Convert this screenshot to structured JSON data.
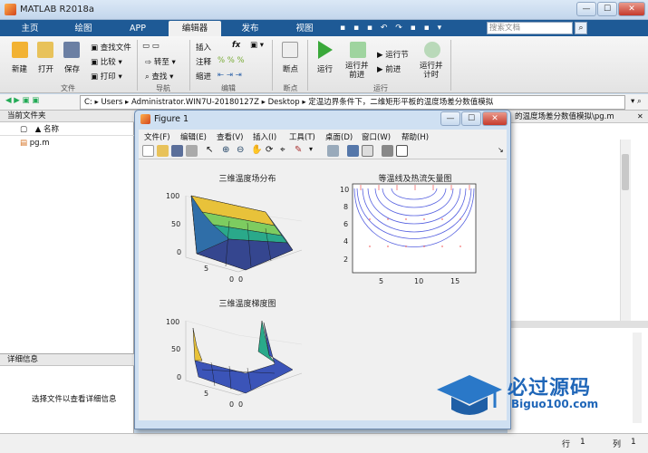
{
  "app": {
    "title": "MATLAB R2018a"
  },
  "window_controls": {
    "minimize": "—",
    "maximize": "☐",
    "close": "✕"
  },
  "tabs": [
    {
      "label": "主页"
    },
    {
      "label": "绘图"
    },
    {
      "label": "APP"
    },
    {
      "label": "编辑器"
    },
    {
      "label": "发布"
    },
    {
      "label": "视图"
    }
  ],
  "search": {
    "placeholder": "搜索文档"
  },
  "ribbon": {
    "file": {
      "new": "新建",
      "open": "打开",
      "save": "保存",
      "find_files": "查找文件",
      "compare": "比较",
      "print": "打印",
      "group": "文件"
    },
    "navigate": {
      "insert": "插入",
      "goto": "转至",
      "find": "查找",
      "group": "导航"
    },
    "edit": {
      "comment": "注释",
      "indent": "缩进",
      "fx": "fx",
      "group": "编辑"
    },
    "breakpoints": {
      "label": "断点",
      "group": "断点"
    },
    "run": {
      "run": "运行",
      "run_advance": "运行并\n前进",
      "run_section": "运行节",
      "advance": "前进",
      "run_time": "运行并\n计时",
      "group": "运行"
    }
  },
  "address": {
    "segments": [
      "C:",
      "Users",
      "Administrator.WIN7U-20180127Z",
      "Desktop",
      "定温边界条件下，二维矩形平板的温度场差分数值模拟"
    ]
  },
  "left_panel": {
    "title": "当前文件夹",
    "column": "名称",
    "sort_indicator": "▲",
    "files": [
      {
        "name": "pg.m"
      }
    ]
  },
  "details": {
    "title": "详细信息",
    "empty_text": "选择文件以查看详细信息"
  },
  "editor_tab": {
    "label": "的温度场差分数值模拟\\pg.m"
  },
  "status": {
    "row_label": "行",
    "row": "1",
    "col_label": "列",
    "col": "1"
  },
  "figure": {
    "title": "Figure 1",
    "menu": [
      "文件(F)",
      "编辑(E)",
      "查看(V)",
      "插入(I)",
      "工具(T)",
      "桌面(D)",
      "窗口(W)",
      "帮助(H)"
    ],
    "plots": {
      "p1": {
        "title": "三维温度场分布",
        "z_ticks": [
          "100",
          "50",
          "0"
        ],
        "y_ticks": [
          "5",
          "0"
        ],
        "x_ticks": [
          "0"
        ]
      },
      "p2": {
        "title": "等温线及热流矢量图",
        "y_ticks": [
          "10",
          "8",
          "6",
          "4",
          "2"
        ],
        "x_ticks": [
          "5",
          "10",
          "15"
        ]
      },
      "p3": {
        "title": "三维温度梯度图",
        "z_ticks": [
          "100",
          "50",
          "0"
        ],
        "y_ticks": [
          "5",
          "0"
        ],
        "x_ticks": [
          "0"
        ]
      }
    }
  },
  "watermark": {
    "cn": "必过源码",
    "url": "Biguo100.com"
  }
}
